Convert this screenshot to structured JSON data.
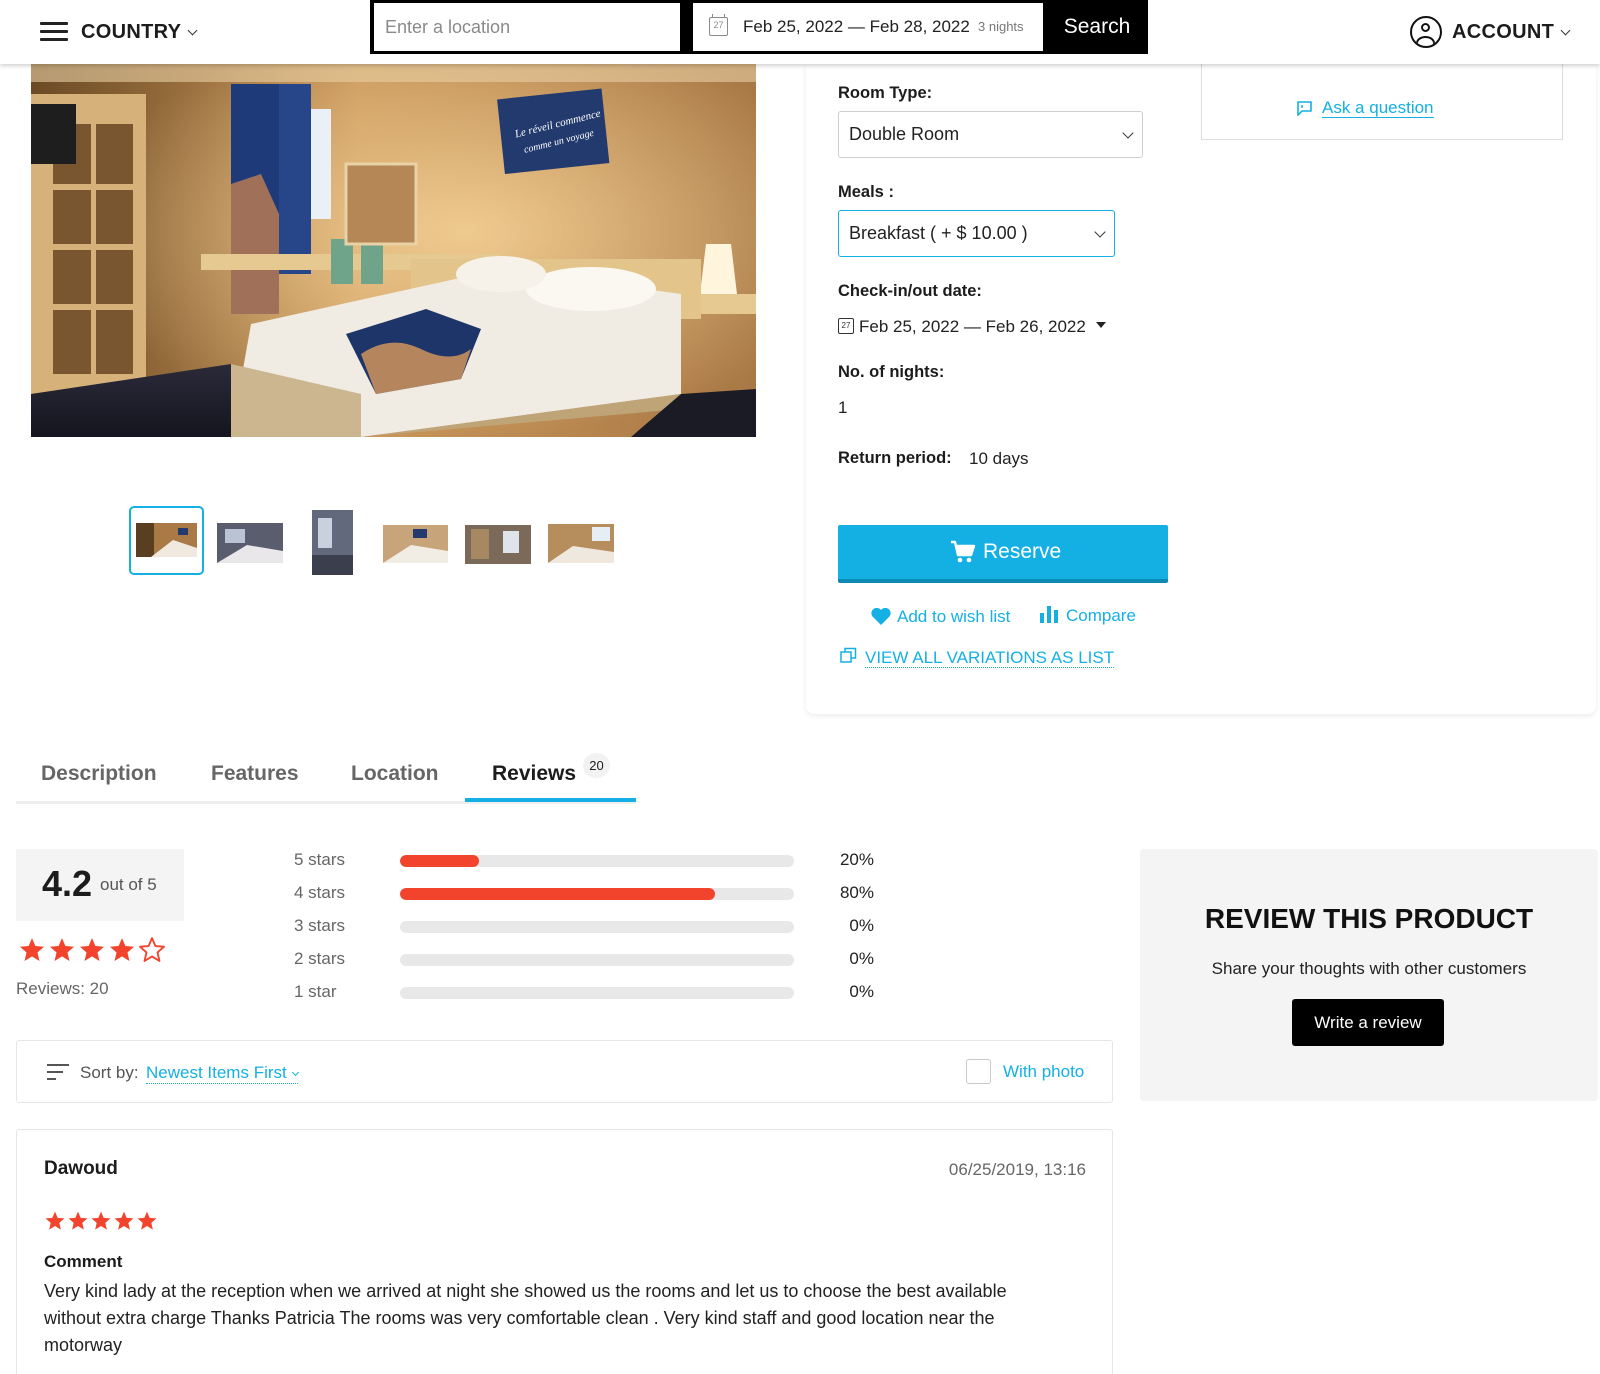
{
  "header": {
    "country_label": "COUNTRY",
    "location_placeholder": "Enter a location",
    "date_range": "Feb 25, 2022 — Feb 28, 2022",
    "calendar_day": "27",
    "nights": "3  nights",
    "search_label": "Search",
    "account_label": "ACCOUNT"
  },
  "gallery": {
    "main_wall_sign": "\"Le réveil commence comme un voyage\"",
    "thumbnail_count": 6,
    "selected_index": 0
  },
  "product_panel": {
    "ask_question": "Ask a question",
    "room_type_label": "Room Type:",
    "room_type_value": "Double Room",
    "meals_label": "Meals :",
    "meals_value": "Breakfast ( + $ 10.00 )",
    "checkin_label": "Check-in/out date:",
    "checkin_value": "Feb 25, 2022 — Feb 26, 2022",
    "calendar_day": "27",
    "nights_label": "No. of nights:",
    "nights_value": "1",
    "return_label": "Return period:",
    "return_value": "10 days",
    "reserve_label": "Reserve",
    "wishlist_label": "Add to wish list",
    "compare_label": "Compare",
    "variations_label": "VIEW ALL VARIATIONS AS LIST"
  },
  "tabs": [
    {
      "label": "Description"
    },
    {
      "label": "Features"
    },
    {
      "label": "Location"
    },
    {
      "label": "Reviews",
      "badge": "20"
    }
  ],
  "rating": {
    "score": "4.2",
    "out_of": "out of 5",
    "stars_filled": 4,
    "reviews_label": "Reviews: 20",
    "breakdown": [
      {
        "label": "5 stars",
        "percent": 20,
        "percent_label": "20%"
      },
      {
        "label": "4 stars",
        "percent": 80,
        "percent_label": "80%"
      },
      {
        "label": "3 stars",
        "percent": 0,
        "percent_label": "0%"
      },
      {
        "label": "2 stars",
        "percent": 0,
        "percent_label": "0%"
      },
      {
        "label": "1 star",
        "percent": 0,
        "percent_label": "0%"
      }
    ]
  },
  "review_product": {
    "title": "REVIEW THIS PRODUCT",
    "subtitle": "Share your thoughts with other customers",
    "button": "Write a review"
  },
  "sort": {
    "label": "Sort by:",
    "value": "Newest Items First",
    "with_photo": "With photo"
  },
  "reviews": [
    {
      "author": "Dawoud",
      "date": "06/25/2019, 13:16",
      "stars": 5,
      "comment_label": "Comment",
      "text": "Very kind lady at the reception when we arrived at night she showed us the rooms and let us to choose the best available without extra charge Thanks Patricia The rooms was very comfortable clean . Very kind staff and good location near the motorway"
    }
  ],
  "colors": {
    "accent": "#14b0e4",
    "star": "#f2432c",
    "bar_fill": "#f2432c"
  }
}
